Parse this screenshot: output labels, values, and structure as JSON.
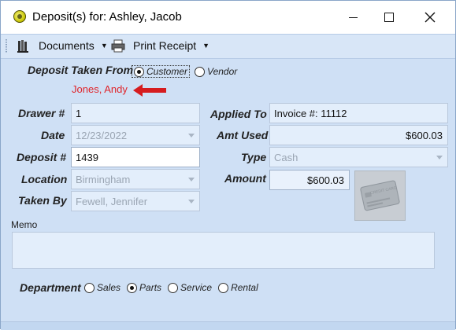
{
  "window": {
    "title": "Deposit(s) for: Ashley, Jacob"
  },
  "toolbar": {
    "documents_label": "Documents",
    "print_receipt_label": "Print Receipt"
  },
  "deposit_taken_from": {
    "label": "Deposit Taken From",
    "options": [
      "Customer",
      "Vendor"
    ],
    "selected": "Customer",
    "name": "Jones, Andy"
  },
  "fields": {
    "drawer": {
      "label": "Drawer #",
      "value": "1"
    },
    "date": {
      "label": "Date",
      "value": "12/23/2022"
    },
    "deposit": {
      "label": "Deposit #",
      "value": "1439"
    },
    "location": {
      "label": "Location",
      "value": "Birmingham"
    },
    "taken_by": {
      "label": "Taken By",
      "value": "Fewell, Jennifer"
    },
    "applied_to": {
      "label": "Applied To",
      "value": "Invoice #: 11112"
    },
    "amt_used": {
      "label": "Amt Used",
      "value": "$600.03"
    },
    "type": {
      "label": "Type",
      "value": "Cash"
    },
    "amount": {
      "label": "Amount",
      "value": "$600.03"
    }
  },
  "card_image_text": "CREDIT CARD",
  "memo": {
    "label": "Memo",
    "value": ""
  },
  "department": {
    "label": "Department",
    "options": [
      "Sales",
      "Parts",
      "Service",
      "Rental"
    ],
    "selected": "Parts"
  },
  "colors": {
    "accent_red": "#e0242a",
    "background": "#cfe0f5"
  }
}
